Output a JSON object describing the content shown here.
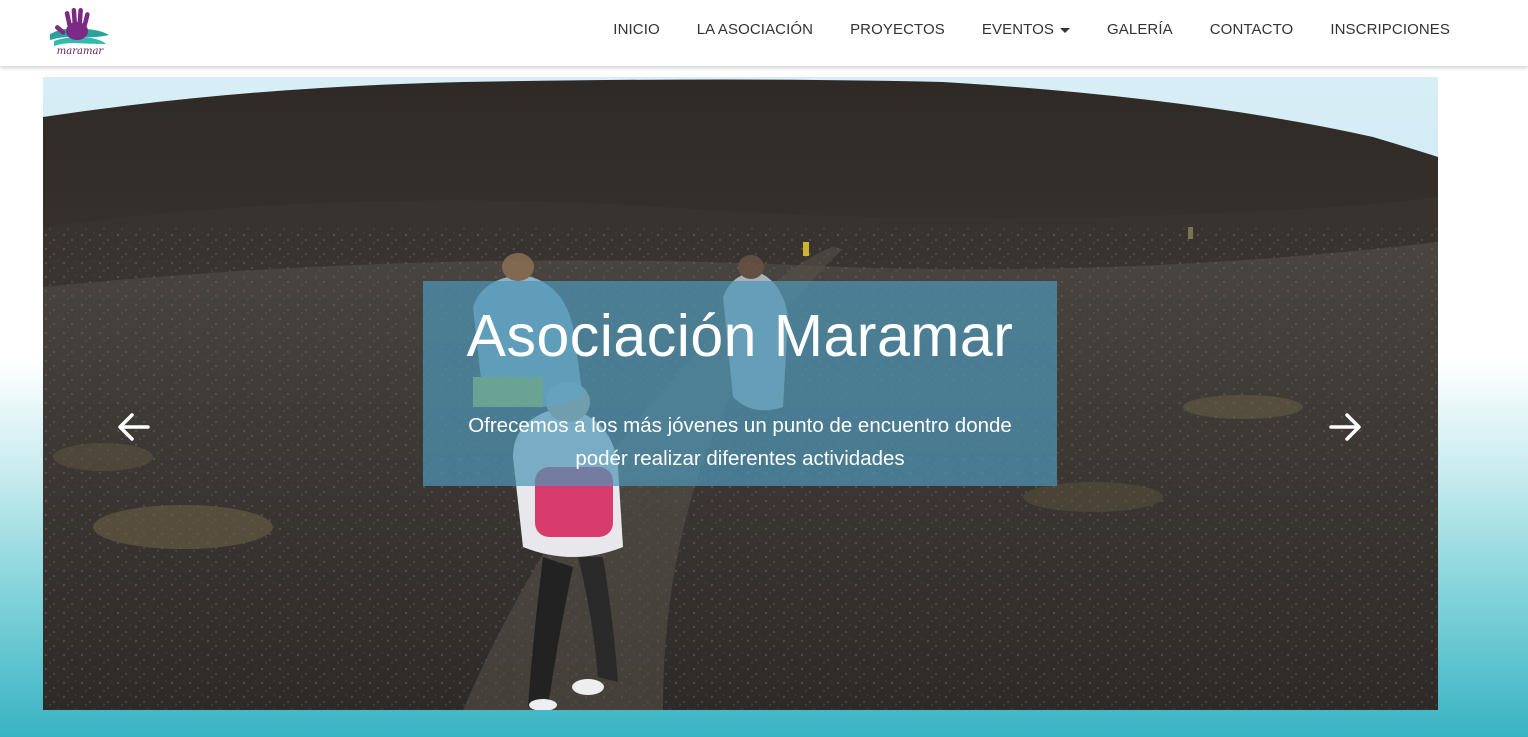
{
  "site": {
    "logo_text": "maramar",
    "logo_icon": "handprint-logo-icon"
  },
  "nav": {
    "items": [
      {
        "label": "INICIO"
      },
      {
        "label": "LA ASOCIACIÓN"
      },
      {
        "label": "PROYECTOS"
      },
      {
        "label": "EVENTOS",
        "has_dropdown": true
      },
      {
        "label": "GALERÍA"
      },
      {
        "label": "CONTACTO"
      },
      {
        "label": "INSCRIPCIONES"
      }
    ]
  },
  "hero": {
    "title": "Asociación Maramar",
    "subtitle": "Ofrecemos a los más jóvenes un punto de encuentro donde podér realizar diferentes actividades",
    "prev_icon": "arrow-left-icon",
    "next_icon": "arrow-right-icon"
  },
  "colors": {
    "caption_bg": "#4d96b6",
    "page_accent": "#38b3c3",
    "logo_purple": "#7b2b83",
    "logo_teal": "#2aa39c"
  }
}
